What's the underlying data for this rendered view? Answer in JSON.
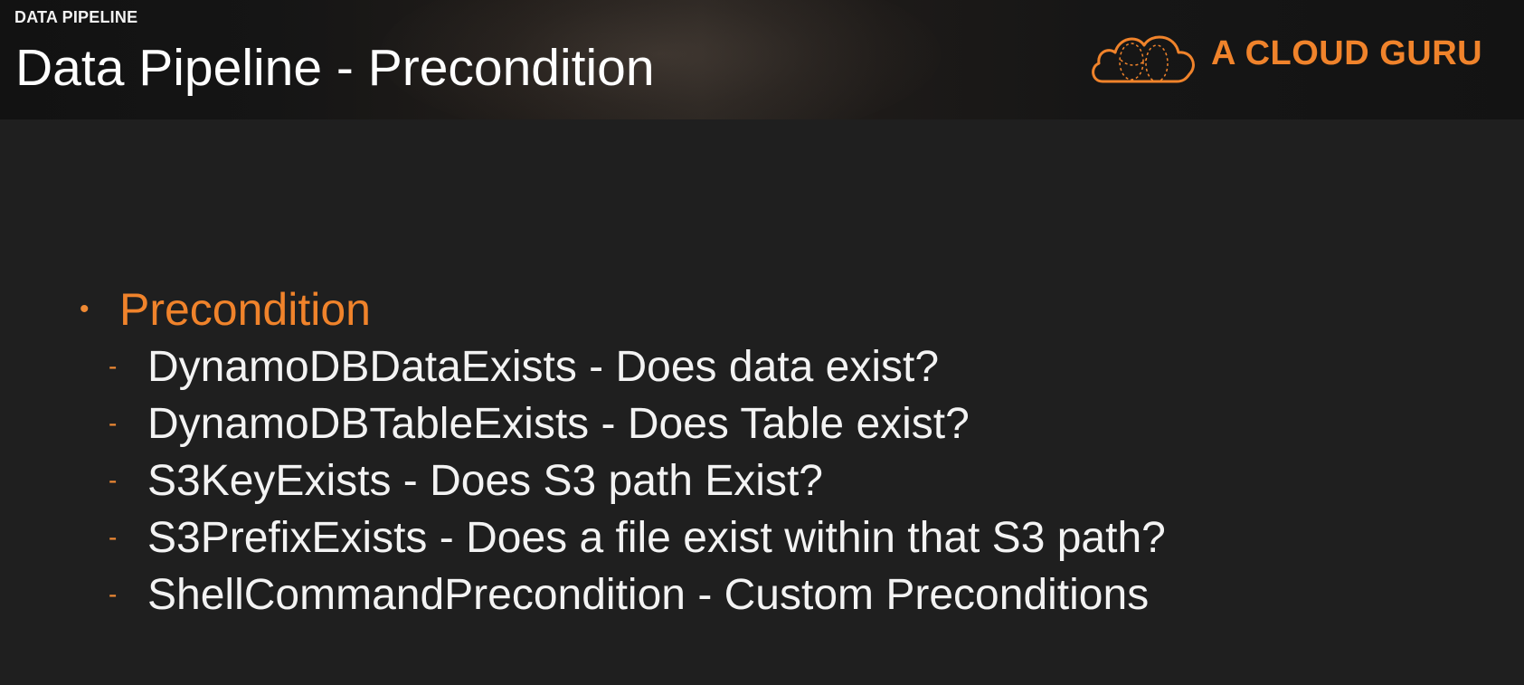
{
  "header": {
    "section_label": "DATA PIPELINE",
    "title": "Data Pipeline - Precondition",
    "logo_text": "A CLOUD GURU",
    "logo_icon": "cloud-icon"
  },
  "content": {
    "heading": {
      "bullet": "•",
      "text": "Precondition"
    },
    "items": [
      {
        "marker": "-",
        "text": "DynamoDBDataExists - Does data exist?"
      },
      {
        "marker": "-",
        "text": "DynamoDBTableExists - Does Table exist?"
      },
      {
        "marker": "-",
        "text": "S3KeyExists - Does S3 path Exist?"
      },
      {
        "marker": "-",
        "text": "S3PrefixExists - Does a file exist within that S3 path?"
      },
      {
        "marker": "-",
        "text": "ShellCommandPrecondition - Custom Preconditions"
      }
    ]
  },
  "colors": {
    "accent": "#f0832b",
    "background": "#1f1f1f",
    "text": "#f3f3f3"
  }
}
